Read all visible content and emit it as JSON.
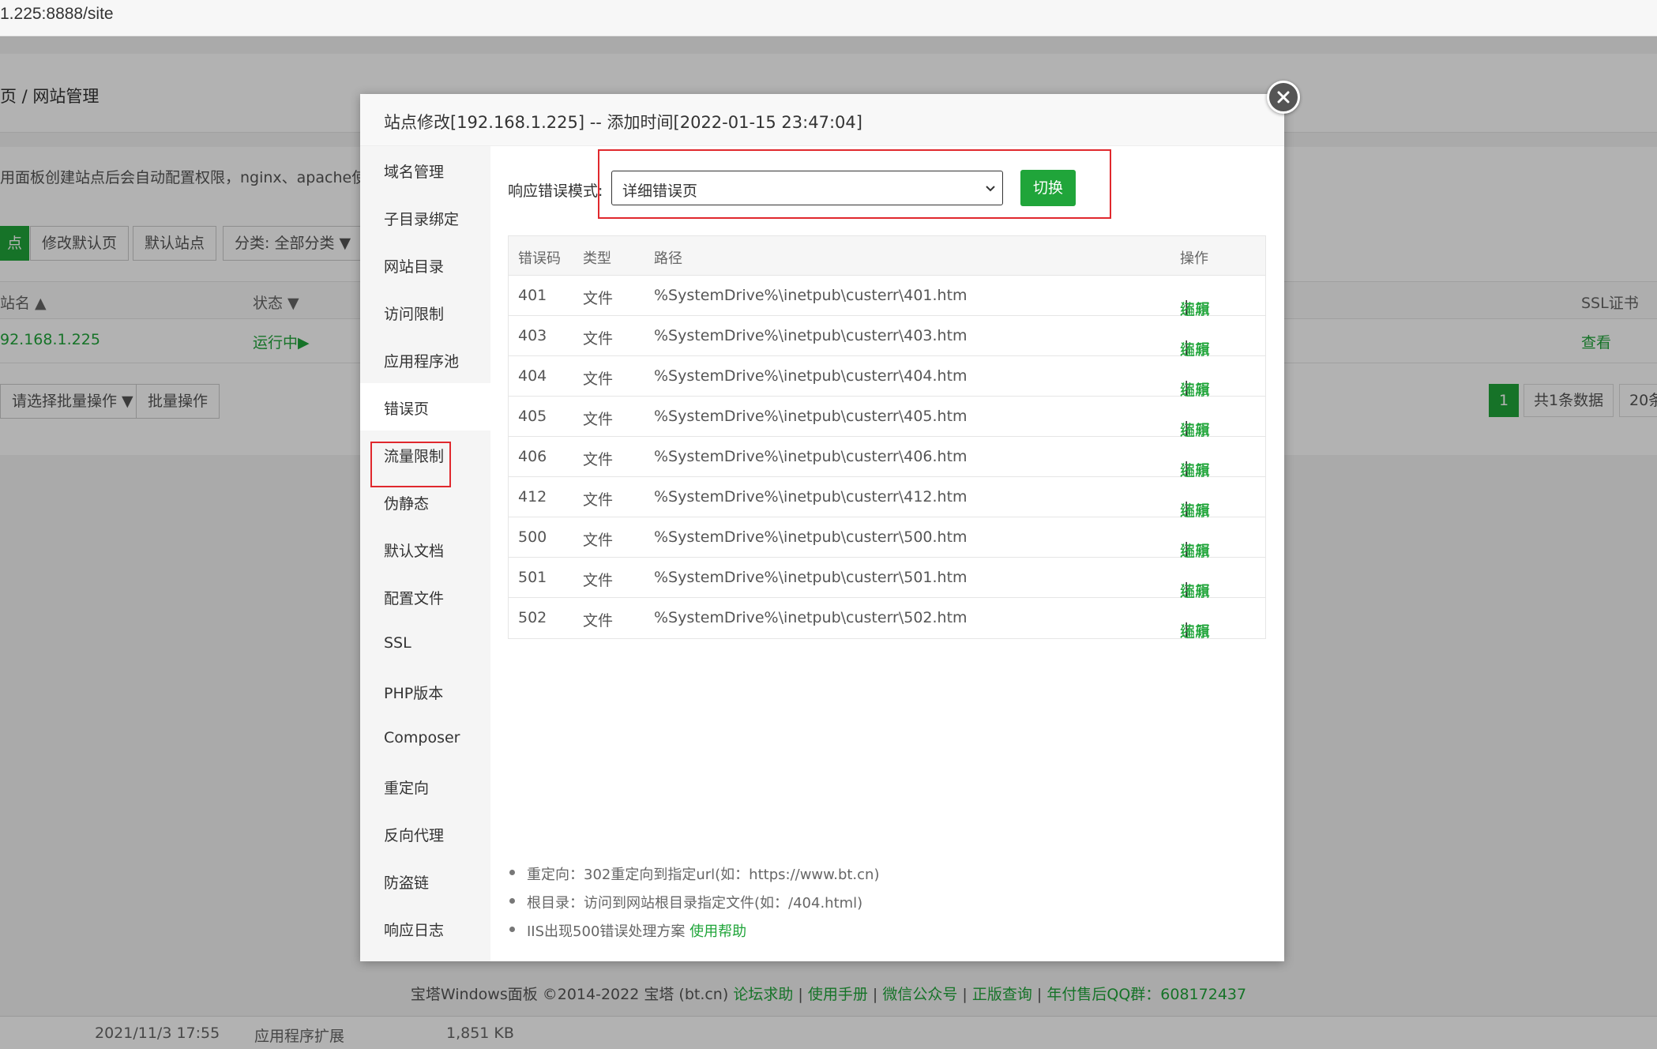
{
  "browser": {
    "url": "1.225:8888/site"
  },
  "background": {
    "breadcrumb": "页  /  网站管理",
    "tip": "用面板创建站点后会自动配置权限，nginx、apache使用w",
    "buttons": [
      "点",
      "修改默认页",
      "默认站点",
      "分类: 全部分类 ▼"
    ],
    "table_headers": {
      "name": "站名 ▲",
      "status": "状态 ▼",
      "ssl": "SSL证书"
    },
    "row": {
      "name": "92.168.1.225",
      "status": "运行中▶",
      "ssl": "查看"
    },
    "batch_select": "请选择批量操作 ▼",
    "batch_button": "批量操作",
    "pager": {
      "current": "1",
      "total": "共1条数据",
      "per_page": "20条"
    },
    "copyright": {
      "text": "宝塔Windows面板 ©2014-2022 宝塔 (bt.cn)",
      "links": [
        "论坛求助",
        "使用手册",
        "微信公众号",
        "正版查询",
        "年付售后QQ群：608172437"
      ],
      "separator": "|"
    },
    "file_row": {
      "date": "2021/11/3 17:55",
      "type": "应用程序扩展",
      "size": "1,851 KB"
    }
  },
  "modal": {
    "title": "站点修改[192.168.1.225] -- 添加时间[2022-01-15 23:47:04]",
    "sidebar": [
      "域名管理",
      "子目录绑定",
      "网站目录",
      "访问限制",
      "应用程序池",
      "错误页",
      "流量限制",
      "伪静态",
      "默认文档",
      "配置文件",
      "SSL",
      "PHP版本",
      "Composer",
      "重定向",
      "反向代理",
      "防盗链",
      "响应日志"
    ],
    "active_index": 5,
    "mode_label": "响应错误模式:",
    "mode_value": "详细错误页",
    "switch_label": "切换",
    "table": {
      "headers": {
        "code": "错误码",
        "type": "类型",
        "path": "路径",
        "op": "操作"
      },
      "rows": [
        {
          "code": "401",
          "type": "文件",
          "path": "%SystemDrive%\\inetpub\\custerr\\401.htm"
        },
        {
          "code": "403",
          "type": "文件",
          "path": "%SystemDrive%\\inetpub\\custerr\\403.htm"
        },
        {
          "code": "404",
          "type": "文件",
          "path": "%SystemDrive%\\inetpub\\custerr\\404.htm"
        },
        {
          "code": "405",
          "type": "文件",
          "path": "%SystemDrive%\\inetpub\\custerr\\405.htm"
        },
        {
          "code": "406",
          "type": "文件",
          "path": "%SystemDrive%\\inetpub\\custerr\\406.htm"
        },
        {
          "code": "412",
          "type": "文件",
          "path": "%SystemDrive%\\inetpub\\custerr\\412.htm"
        },
        {
          "code": "500",
          "type": "文件",
          "path": "%SystemDrive%\\inetpub\\custerr\\500.htm"
        },
        {
          "code": "501",
          "type": "文件",
          "path": "%SystemDrive%\\inetpub\\custerr\\501.htm"
        },
        {
          "code": "502",
          "type": "文件",
          "path": "%SystemDrive%\\inetpub\\custerr\\502.htm"
        }
      ],
      "edit_label": "编辑",
      "op_separator": "|",
      "restore_label": "还原"
    },
    "notes": [
      "重定向：302重定向到指定url(如：https://www.bt.cn)",
      "根目录：访问到网站根目录指定文件(如：/404.html)",
      "IIS出现500错误处理方案"
    ],
    "help_link": "使用帮助"
  },
  "colors": {
    "accent": "#20a53a",
    "highlight": "#e0282d"
  },
  "icons": {
    "close": "close-icon",
    "select": "chevron-down-icon"
  }
}
